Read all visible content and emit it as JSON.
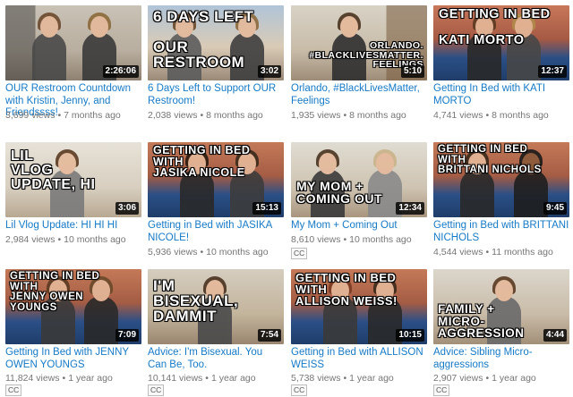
{
  "videos": [
    {
      "title": "OUR Restroom Countdown with Kristin, Jenny, and Friendssss!",
      "views": "3,699 views",
      "age": "7 months ago",
      "duration": "2:26:06",
      "overlay": "",
      "cc": ""
    },
    {
      "title": "6 Days Left to Support OUR Restroom!",
      "views": "2,038 views",
      "age": "8 months ago",
      "duration": "3:02",
      "overlay": "6 DAYS LEFT\n\nOUR\nRESTROOM",
      "cc": ""
    },
    {
      "title": "Orlando, #BlackLivesMatter, Feelings",
      "views": "1,935 views",
      "age": "8 months ago",
      "duration": "5:10",
      "overlay": "ORLANDO.\n#BLACKLIVESMATTER.\nFEELINGS",
      "cc": ""
    },
    {
      "title": "Getting In Bed with KATI MORTO",
      "views": "4,741 views",
      "age": "8 months ago",
      "duration": "12:37",
      "overlay": "GETTING IN BED\n\nKATI MORTO",
      "cc": ""
    },
    {
      "title": "Lil Vlog Update: HI HI HI",
      "views": "2,984 views",
      "age": "10 months ago",
      "duration": "3:06",
      "overlay": "LIL\nVLOG\nUPDATE, HI",
      "cc": ""
    },
    {
      "title": "Getting in Bed with JASIKA NICOLE!",
      "views": "5,936 views",
      "age": "10 months ago",
      "duration": "15:13",
      "overlay": "GETTING IN BED\nWITH\nJASIKA NICOLE",
      "cc": ""
    },
    {
      "title": "My Mom + Coming Out",
      "views": "8,610 views",
      "age": "10 months ago",
      "duration": "12:34",
      "overlay": "MY MOM +\nCOMING OUT",
      "cc": "CC"
    },
    {
      "title": "Getting in Bed with BRITTANI NICHOLS",
      "views": "4,544 views",
      "age": "11 months ago",
      "duration": "9:45",
      "overlay": "GETTING IN BED\nWITH\nBRITTANI NICHOLS",
      "cc": ""
    },
    {
      "title": "Getting In Bed with JENNY OWEN YOUNGS",
      "views": "11,824 views",
      "age": "1 year ago",
      "duration": "7:09",
      "overlay": "GETTING IN BED\nWITH\nJENNY OWEN\nYOUNGS",
      "cc": "CC"
    },
    {
      "title": "Advice: I'm Bisexual. You Can Be, Too.",
      "views": "10,141 views",
      "age": "1 year ago",
      "duration": "7:54",
      "overlay": "I'M\nBISEXUAL,\nDAMMIT",
      "cc": "CC"
    },
    {
      "title": "Getting in Bed with ALLISON WEISS",
      "views": "5,738 views",
      "age": "1 year ago",
      "duration": "10:15",
      "overlay": "GETTING IN BED\nWITH\nALLISON WEISS!",
      "cc": "CC"
    },
    {
      "title": "Advice: Sibling Micro-aggressions",
      "views": "2,907 views",
      "age": "1 year ago",
      "duration": "4:44",
      "overlay": "FAMILY +\nMICRO-\nAGGRESSION",
      "cc": "CC"
    }
  ]
}
